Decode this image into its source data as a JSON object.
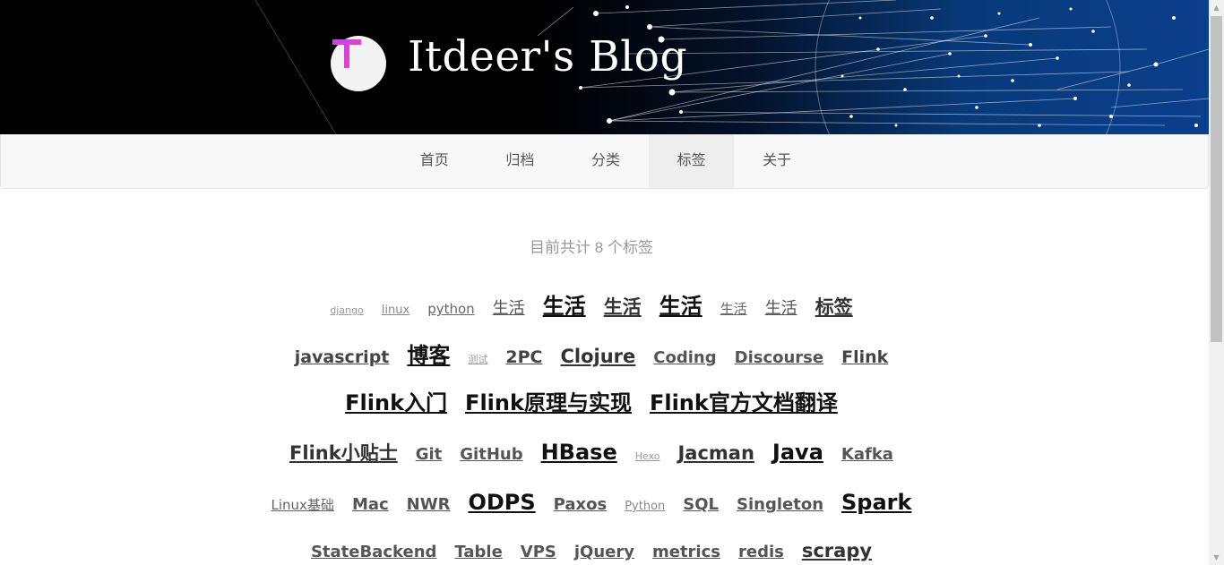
{
  "header": {
    "site_title": "Itdeer's Blog",
    "logo_letter": "T"
  },
  "nav": {
    "items": [
      {
        "label": "首页",
        "active": false
      },
      {
        "label": "归档",
        "active": false
      },
      {
        "label": "分类",
        "active": false
      },
      {
        "label": "标签",
        "active": true
      },
      {
        "label": "关于",
        "active": false
      }
    ]
  },
  "tags": {
    "count_text": "目前共计 8 个标签",
    "rows": [
      [
        {
          "label": "django",
          "size": "s1"
        },
        {
          "label": "linux",
          "size": "s2"
        },
        {
          "label": "python",
          "size": "s3"
        },
        {
          "label": "生活",
          "size": "s4"
        },
        {
          "label": "生活",
          "size": "s7"
        },
        {
          "label": "生活",
          "size": "s6"
        },
        {
          "label": "生活",
          "size": "s7"
        },
        {
          "label": "生活",
          "size": "s3"
        },
        {
          "label": "生活",
          "size": "s4"
        },
        {
          "label": "标签",
          "size": "s6"
        }
      ],
      [
        {
          "label": "javascript",
          "size": "s5"
        },
        {
          "label": "博客",
          "size": "s7"
        },
        {
          "label": "测试",
          "size": "s1"
        },
        {
          "label": "2PC",
          "size": "s5"
        },
        {
          "label": "Clojure",
          "size": "s6"
        },
        {
          "label": "Coding",
          "size": "s4b"
        },
        {
          "label": "Discourse",
          "size": "s4b"
        },
        {
          "label": "Flink",
          "size": "s4c"
        }
      ],
      [
        {
          "label": "Flink入门",
          "size": "s7"
        },
        {
          "label": "Flink原理与实现",
          "size": "s7"
        },
        {
          "label": "Flink官方文档翻译",
          "size": "s7"
        }
      ],
      [
        {
          "label": "Flink小贴士",
          "size": "s6"
        },
        {
          "label": "Git",
          "size": "s4b"
        },
        {
          "label": "GitHub",
          "size": "s4b"
        },
        {
          "label": "HBase",
          "size": "s7"
        },
        {
          "label": "Hexo",
          "size": "s1"
        },
        {
          "label": "Jacman",
          "size": "s6"
        },
        {
          "label": "Java",
          "size": "s7"
        },
        {
          "label": "Kafka",
          "size": "s4b"
        }
      ],
      [
        {
          "label": "Linux基础",
          "size": "s3"
        },
        {
          "label": "Mac",
          "size": "s4b"
        },
        {
          "label": "NWR",
          "size": "s4b"
        },
        {
          "label": "ODPS",
          "size": "s7"
        },
        {
          "label": "Paxos",
          "size": "s4b"
        },
        {
          "label": "Python",
          "size": "s2"
        },
        {
          "label": "SQL",
          "size": "s4b"
        },
        {
          "label": "Singleton",
          "size": "s4b"
        },
        {
          "label": "Spark",
          "size": "s7"
        }
      ],
      [
        {
          "label": "StateBackend",
          "size": "s4b"
        },
        {
          "label": "Table",
          "size": "s4b"
        },
        {
          "label": "VPS",
          "size": "s4b"
        },
        {
          "label": "jQuery",
          "size": "s4b"
        },
        {
          "label": "metrics",
          "size": "s4b"
        },
        {
          "label": "redis",
          "size": "s4b"
        },
        {
          "label": "scrapy",
          "size": "s6"
        }
      ]
    ]
  }
}
